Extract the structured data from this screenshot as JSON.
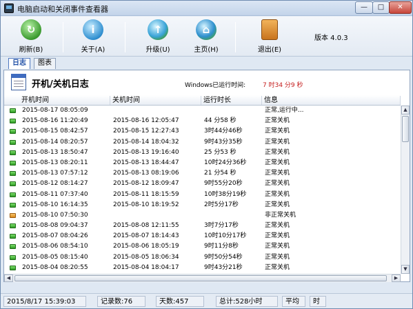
{
  "window": {
    "title": "电脑启动和关闭事件查看器"
  },
  "toolbar": {
    "refresh_label": "刷新(B)",
    "about_label": "关于(A)",
    "upgrade_label": "升级(U)",
    "home_label": "主页(H)",
    "exit_label": "退出(E)",
    "version_text": "版本 4.0.3"
  },
  "tabs": [
    {
      "label": "日志",
      "active": true
    },
    {
      "label": "图表",
      "active": false
    }
  ],
  "log": {
    "title": "开机/关机日志",
    "uptime_label": "Windows已运行时间:",
    "uptime_value": "7 时34 分9 秒"
  },
  "table": {
    "columns": [
      "开机时间",
      "关机时间",
      "运行时长",
      "信息"
    ],
    "rows": [
      {
        "status": "ok",
        "start": "2015-08-17 08:05:09",
        "end": "",
        "duration": "",
        "info": "正常,运行中..."
      },
      {
        "status": "ok",
        "start": "2015-08-16 11:20:49",
        "end": "2015-08-16 12:05:47",
        "duration": "44 分58 秒",
        "info": "正常关机"
      },
      {
        "status": "ok",
        "start": "2015-08-15 08:42:57",
        "end": "2015-08-15 12:27:43",
        "duration": "3时44分46秒",
        "info": "正常关机"
      },
      {
        "status": "ok",
        "start": "2015-08-14 08:20:57",
        "end": "2015-08-14 18:04:32",
        "duration": "9时43分35秒",
        "info": "正常关机"
      },
      {
        "status": "ok",
        "start": "2015-08-13 18:50:47",
        "end": "2015-08-13 19:16:40",
        "duration": "25 分53 秒",
        "info": "正常关机"
      },
      {
        "status": "ok",
        "start": "2015-08-13 08:20:11",
        "end": "2015-08-13 18:44:47",
        "duration": "10时24分36秒",
        "info": "正常关机"
      },
      {
        "status": "ok",
        "start": "2015-08-13 07:57:12",
        "end": "2015-08-13 08:19:06",
        "duration": "21 分54 秒",
        "info": "正常关机"
      },
      {
        "status": "ok",
        "start": "2015-08-12 08:14:27",
        "end": "2015-08-12 18:09:47",
        "duration": "9时55分20秒",
        "info": "正常关机"
      },
      {
        "status": "ok",
        "start": "2015-08-11 07:37:40",
        "end": "2015-08-11 18:15:59",
        "duration": "10时38分19秒",
        "info": "正常关机"
      },
      {
        "status": "ok",
        "start": "2015-08-10 16:14:35",
        "end": "2015-08-10 18:19:52",
        "duration": "2时5分17秒",
        "info": "正常关机"
      },
      {
        "status": "bad",
        "start": "2015-08-10 07:50:30",
        "end": "",
        "duration": "",
        "info": "非正常关机"
      },
      {
        "status": "ok",
        "start": "2015-08-08 09:04:37",
        "end": "2015-08-08 12:11:55",
        "duration": "3时7分17秒",
        "info": "正常关机"
      },
      {
        "status": "ok",
        "start": "2015-08-07 08:04:26",
        "end": "2015-08-07 18:14:43",
        "duration": "10时10分17秒",
        "info": "正常关机"
      },
      {
        "status": "ok",
        "start": "2015-08-06 08:54:10",
        "end": "2015-08-06 18:05:19",
        "duration": "9时11分8秒",
        "info": "正常关机"
      },
      {
        "status": "ok",
        "start": "2015-08-05 08:15:40",
        "end": "2015-08-05 18:06:34",
        "duration": "9时50分54秒",
        "info": "正常关机"
      },
      {
        "status": "ok",
        "start": "2015-08-04 08:20:55",
        "end": "2015-08-04 18:04:17",
        "duration": "9时43分21秒",
        "info": "正常关机"
      },
      {
        "status": "ok",
        "start": "2015-08-03 08:38:22",
        "end": "2015-08-03 18:25:34",
        "duration": "9时55分12秒",
        "info": "正常关机"
      }
    ]
  },
  "status": {
    "datetime": "2015/8/17 15:39:03",
    "record_count": "记录数:76",
    "day_count": "天数:457",
    "total_hours": "总计:528小时",
    "avg_label": "平均",
    "avg_unit": "时"
  },
  "colors": {
    "uptime_value": "#c41a1a",
    "ok_status": "#2e9a22",
    "bad_status": "#db8a1b",
    "active_tab": "#1f4fa6"
  },
  "icons": {
    "refresh": "refresh-globe-icon",
    "about": "info-globe-icon",
    "upgrade": "upgrade-globe-icon",
    "home": "home-globe-icon",
    "exit": "exit-door-icon"
  }
}
